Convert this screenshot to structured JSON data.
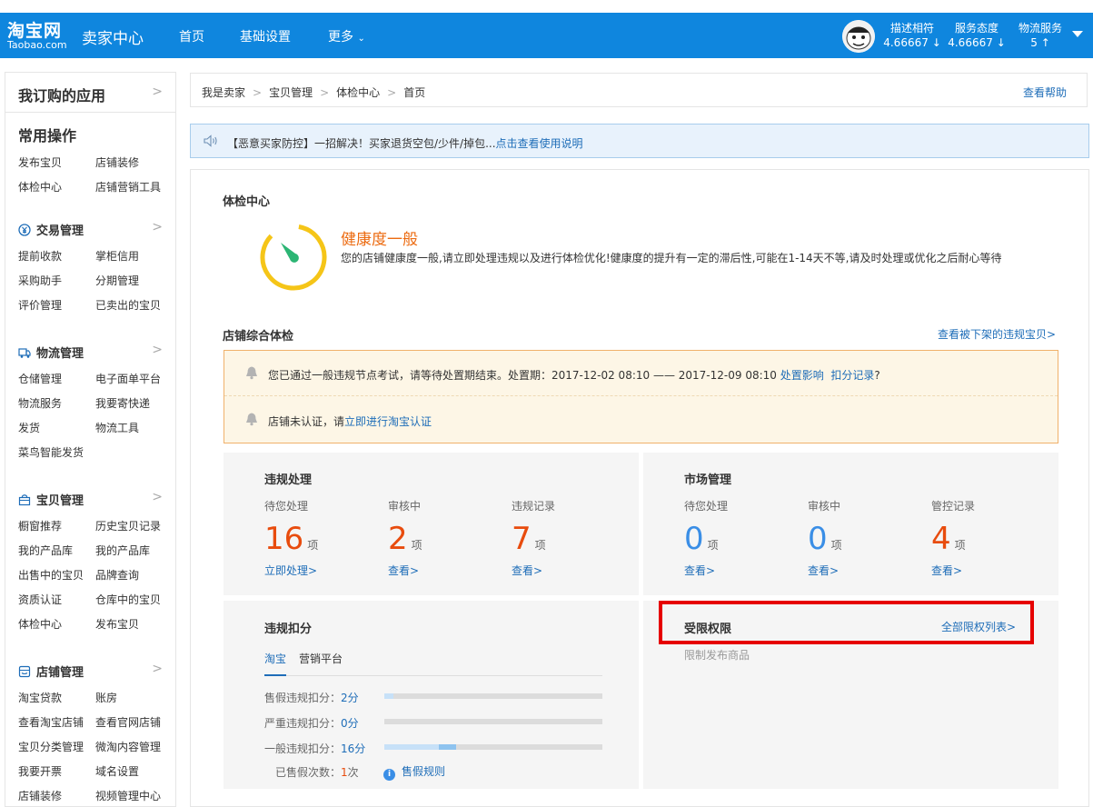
{
  "header": {
    "logo_cn": "淘宝网",
    "logo_en": "Taobao.com",
    "title": "卖家中心",
    "nav": [
      "首页",
      "基础设置",
      "更多"
    ],
    "scores": [
      {
        "label": "描述相符",
        "value": "4.66667",
        "trend": "↓"
      },
      {
        "label": "服务态度",
        "value": "4.66667",
        "trend": "↓"
      },
      {
        "label": "物流服务",
        "value": "5",
        "trend": "↑"
      }
    ]
  },
  "sidebar": {
    "apps_title": "我订购的应用",
    "common_title": "常用操作",
    "common_links": [
      "发布宝贝",
      "店铺装修",
      "体检中心",
      "店铺营销工具"
    ],
    "sections": [
      {
        "title": "交易管理",
        "icon": "yen-icon",
        "links": [
          "提前收款",
          "掌柜信用",
          "采购助手",
          "分期管理",
          "评价管理",
          "已卖出的宝贝"
        ]
      },
      {
        "title": "物流管理",
        "icon": "truck-icon",
        "links": [
          "仓储管理",
          "电子面单平台",
          "物流服务",
          "我要寄快递",
          "发货",
          "物流工具",
          "菜鸟智能发货"
        ]
      },
      {
        "title": "宝贝管理",
        "icon": "bag-icon",
        "links": [
          "橱窗推荐",
          "历史宝贝记录",
          "我的产品库",
          "我的产品库",
          "出售中的宝贝",
          "品牌查询",
          "资质认证",
          "仓库中的宝贝",
          "体检中心",
          "发布宝贝"
        ]
      },
      {
        "title": "店铺管理",
        "icon": "shop-icon",
        "links": [
          "淘宝贷款",
          "账房",
          "查看淘宝店铺",
          "查看官网店铺",
          "宝贝分类管理",
          "微淘内容管理",
          "我要开票",
          "域名设置",
          "店铺装修",
          "视频管理中心"
        ]
      }
    ]
  },
  "breadcrumb": {
    "items": [
      "我是卖家",
      "宝贝管理",
      "体检中心",
      "首页"
    ],
    "sep": ">",
    "help": "查看帮助"
  },
  "notice": {
    "text": "【恶意买家防控】一招解决！买家退货空包/少件/掉包...",
    "link": "点击查看使用说明"
  },
  "health": {
    "section_title": "体检中心",
    "status": "健康度一般",
    "desc": "您的店铺健康度一般,请立即处理违规以及进行体检优化!健康度的提升有一定的滞后性,可能在1-14天不等,请及时处理或优化之后耐心等待",
    "colors": {
      "ring": "#f5c518",
      "needle": "#2cb574",
      "status": "#ec6b11"
    }
  },
  "shop_check": {
    "title": "店铺综合体检",
    "offshelf_link": "查看被下架的违规宝贝>",
    "alerts": [
      {
        "text": "您已通过一般违规节点考试，请等待处置期结束。处置期：2017-12-02 08:10 —— 2017-12-09 08:10 ",
        "links": [
          "处置影响",
          "扣分记录"
        ],
        "suffix": "?"
      },
      {
        "text": "店铺未认证，请",
        "links": [
          "立即进行淘宝认证"
        ],
        "suffix": ""
      }
    ]
  },
  "violation": {
    "title": "违规处理",
    "stats": [
      {
        "label": "待您处理",
        "value": "16",
        "unit": "项",
        "link": "立即处理>"
      },
      {
        "label": "审核中",
        "value": "2",
        "unit": "项",
        "link": "查看>"
      },
      {
        "label": "违规记录",
        "value": "7",
        "unit": "项",
        "link": "查看>"
      }
    ]
  },
  "market": {
    "title": "市场管理",
    "stats": [
      {
        "label": "待您处理",
        "value": "0",
        "unit": "项",
        "link": "查看>"
      },
      {
        "label": "审核中",
        "value": "0",
        "unit": "项",
        "link": "查看>"
      },
      {
        "label": "管控记录",
        "value": "4",
        "unit": "项",
        "link": "查看>"
      }
    ]
  },
  "deduct": {
    "title": "违规扣分",
    "tabs": [
      "淘宝",
      "营销平台"
    ],
    "rows": [
      {
        "label": "售假违规扣分：",
        "value": "2分",
        "fill_from": 0,
        "fill_to": 0.04,
        "color": "#c7e1f8"
      },
      {
        "label": "严重违规扣分：",
        "value": "0分",
        "fill_from": 0,
        "fill_to": 0,
        "color": "#c7e1f8"
      },
      {
        "label": "一般违规扣分：",
        "value": "16分",
        "fill_from": 0,
        "fill_to": 0.33,
        "color": "#c7e1f8",
        "mark_from": 0.25,
        "mark_to": 0.33,
        "mark_color": "#8ec3ef"
      }
    ],
    "sold_label": "已售假次数：",
    "sold_count": "1",
    "sold_unit": "次",
    "rule_link": "售假规则"
  },
  "restrict": {
    "title": "受限权限",
    "all_link": "全部限权列表>",
    "sub": "限制发布商品"
  }
}
